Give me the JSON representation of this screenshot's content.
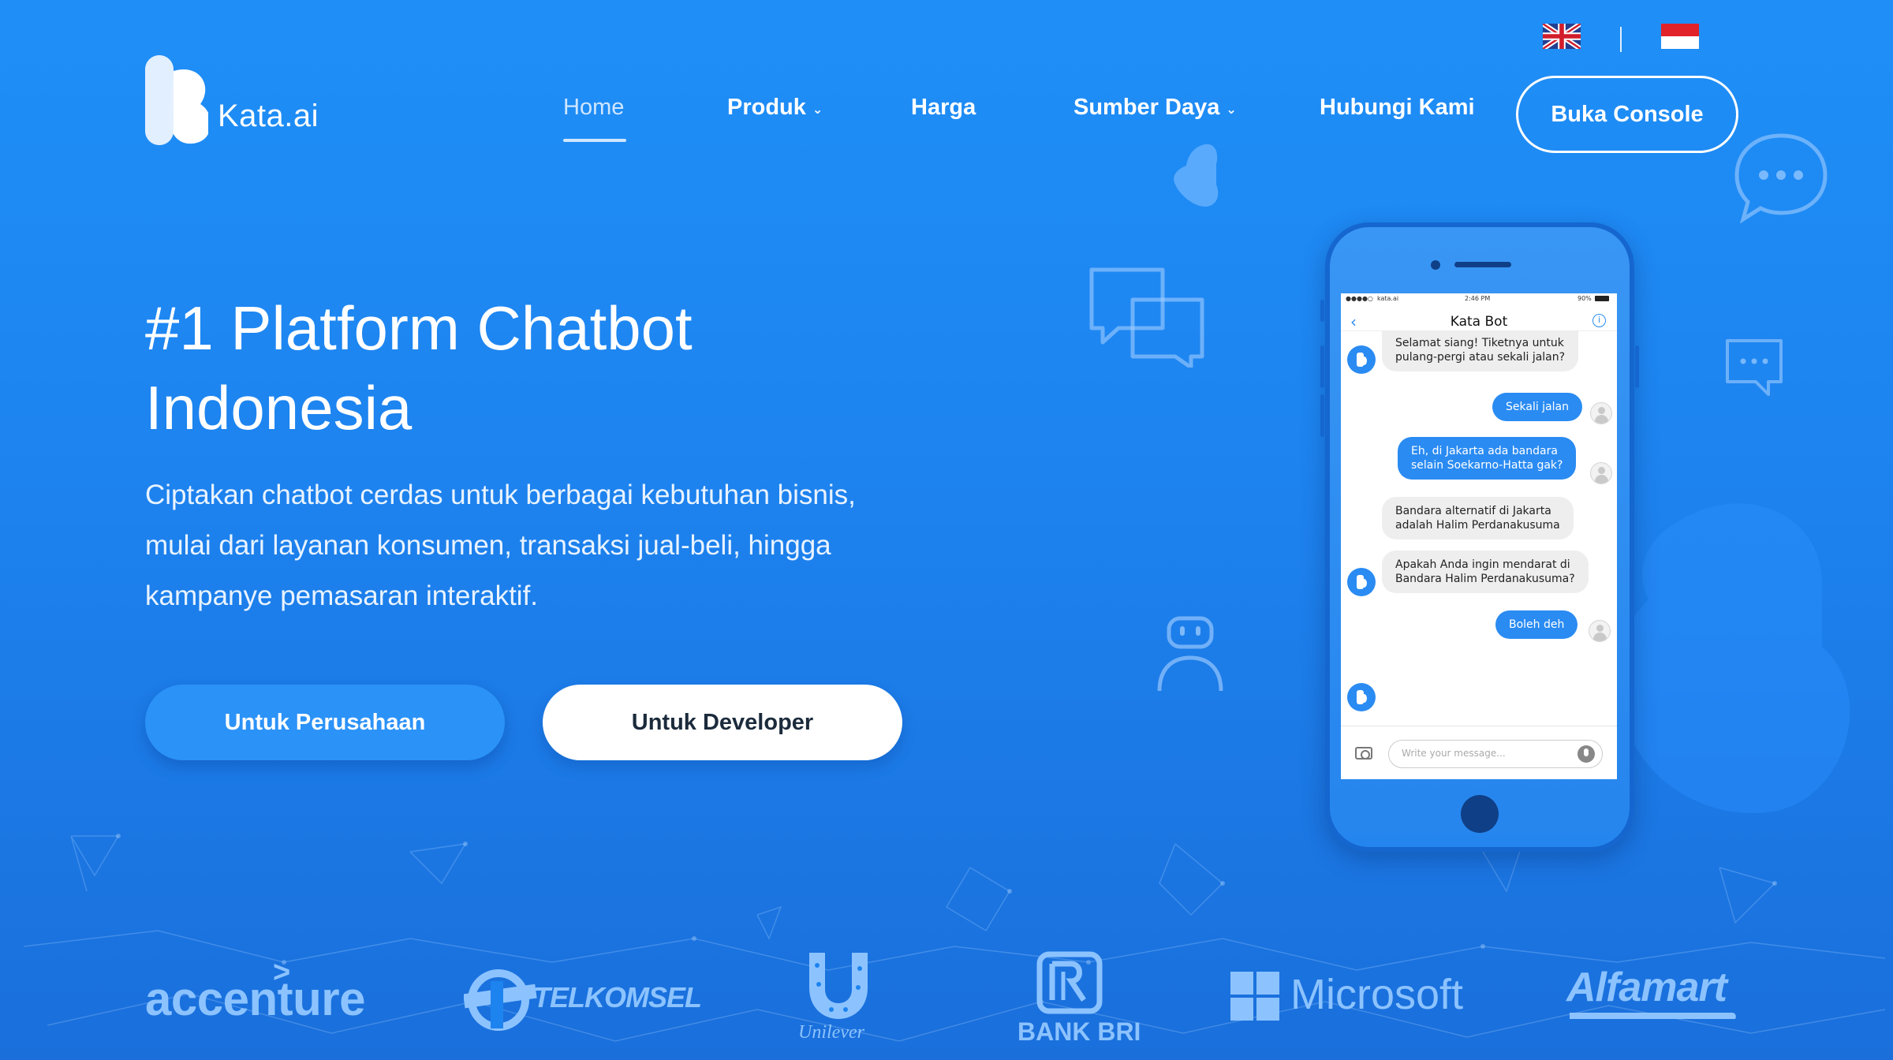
{
  "brand": {
    "name": "Kata.ai"
  },
  "languages": [
    {
      "code": "en",
      "icon": "uk-flag-icon"
    },
    {
      "code": "id",
      "icon": "indonesia-flag-icon"
    }
  ],
  "nav": {
    "items": [
      {
        "label": "Home",
        "active": true,
        "dropdown": false
      },
      {
        "label": "Produk",
        "active": false,
        "dropdown": true
      },
      {
        "label": "Harga",
        "active": false,
        "dropdown": false
      },
      {
        "label": "Sumber Daya",
        "active": false,
        "dropdown": true
      },
      {
        "label": "Hubungi Kami",
        "active": false,
        "dropdown": false
      }
    ],
    "cta": "Buka Console"
  },
  "hero": {
    "title_line1": "#1 Platform Chatbot",
    "title_line2": "Indonesia",
    "subtitle_line1": "Ciptakan chatbot cerdas untuk berbagai kebutuhan bisnis,",
    "subtitle_line2": "mulai dari layanan konsumen, transaksi jual-beli, hingga",
    "subtitle_line3": "kampanye pemasaran interaktif.",
    "primary_button": "Untuk Perusahaan",
    "secondary_button": "Untuk Developer"
  },
  "phone": {
    "status": {
      "carrier": "kata.ai",
      "time": "2:46 PM",
      "battery": "90%"
    },
    "chat_title": "Kata Bot",
    "messages": [
      {
        "from": "bot",
        "text": "Selamat siang! Tiketnya untuk\npulang-pergi atau sekali jalan?"
      },
      {
        "from": "user",
        "text": "Sekali jalan"
      },
      {
        "from": "user",
        "text": "Eh, di Jakarta ada bandara\nselain Soekarno-Hatta gak?"
      },
      {
        "from": "bot",
        "text": "Bandara alternatif di Jakarta\nadalah Halim Perdanakusuma"
      },
      {
        "from": "bot",
        "text": "Apakah Anda ingin mendarat di\nBandara Halim Perdanakusuma?"
      },
      {
        "from": "user",
        "text": "Boleh deh"
      }
    ],
    "input_placeholder": "Write your message..."
  },
  "clients": [
    "accenture",
    "TELKOMSEL",
    "Unilever",
    "BANK BRI",
    "Microsoft",
    "Alfamart"
  ],
  "colors": {
    "background": "#1d83ef",
    "primary_button": "#2b92f8",
    "chat_user_bubble": "#2a8bf2",
    "logo_tint": "#8cc3ff"
  }
}
